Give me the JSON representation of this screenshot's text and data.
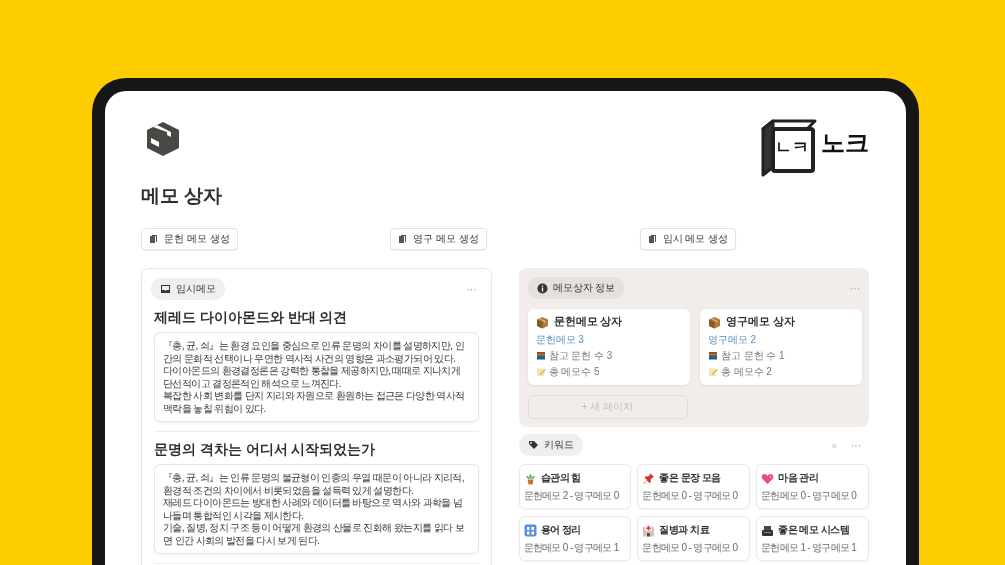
{
  "logo": {
    "mark": "ㄴㅋ",
    "name": "노크"
  },
  "title": "메모 상자",
  "buttons": [
    {
      "label": "문헌 메모 생성"
    },
    {
      "label": "영구 메모 생성"
    },
    {
      "label": "임시 메모 생성"
    }
  ],
  "temp_panel": {
    "tag": "임시메모",
    "more": "···",
    "notes": [
      {
        "title": "제레드 다이아몬드와 반대 의견",
        "paragraphs": [
          "『총, 균, 쇠』는 환경 요인을 중심으로 인류 문명의 차이를 설명하지만, 인간의 문화적 선택이나 우연한 역사적 사건의 영향은 과소평가되어 있다.",
          "다이아몬드의 환경결정론은 강력한 통찰을 제공하지만, 때때로 지나치게 단선적이고 결정론적인 해석으로 느껴진다.",
          "복잡한 사회 변화를 단지 지리와 자원으로 환원하는 접근은 다양한 역사적 맥락을 놓칠 위험이 있다."
        ]
      },
      {
        "title": "문명의 격차는 어디서 시작되었는가",
        "paragraphs": [
          "『총, 균, 쇠』는 인류 문명의 불균형이 인종의 우열 때문이 아니라 지리적, 환경적 조건의 차이에서 비롯되었음을 설득력 있게 설명한다.",
          "재레드 다이아몬드는 방대한 사례와 데이터를 바탕으로 역사와 과학을 넘나들며 통합적인 시각을 제시한다.",
          "기술, 질병, 정치 구조 등이 어떻게 환경의 산물로 진화해 왔는지를 읽다 보면 인간 사회의 발전을 다시 보게 된다."
        ]
      }
    ]
  },
  "info_panel": {
    "tag": "메모상자 정보",
    "more": "···",
    "boxes": [
      {
        "title": "문헌메모 상자",
        "link": "문헌메모 3",
        "stats": [
          {
            "kind": "books",
            "text": "참고 문헌 수 3"
          },
          {
            "kind": "memo",
            "text": "총 메모수 5"
          }
        ]
      },
      {
        "title": "영구메모 상자",
        "link": "영구메모 2",
        "stats": [
          {
            "kind": "books",
            "text": "참고 문헌 수 1"
          },
          {
            "kind": "memo",
            "text": "총 메모수 2"
          }
        ]
      }
    ],
    "new_page": "+ 새 페이지"
  },
  "keywords": {
    "tag": "키워드",
    "collapse": "«",
    "more": "···",
    "items": [
      {
        "kind": "plant",
        "title": "습관의 힘",
        "counts": "문헌메모 2 - 영구메모 0"
      },
      {
        "kind": "pin",
        "title": "좋은 문장 모음",
        "counts": "문헌메모 0 - 영구메모 0"
      },
      {
        "kind": "heart",
        "title": "마음 관리",
        "counts": "문헌메모 0 - 영구메모 0"
      },
      {
        "kind": "numbers",
        "title": "용어 정리",
        "counts": "문헌메모 0 - 영구메모 1"
      },
      {
        "kind": "hospital",
        "title": "질병과 치료",
        "counts": "문헌메모 0 - 영구메모 0"
      },
      {
        "kind": "tray",
        "title": "좋은 메모 시스템",
        "counts": "문헌메모 1 - 영구메모 1"
      }
    ]
  }
}
